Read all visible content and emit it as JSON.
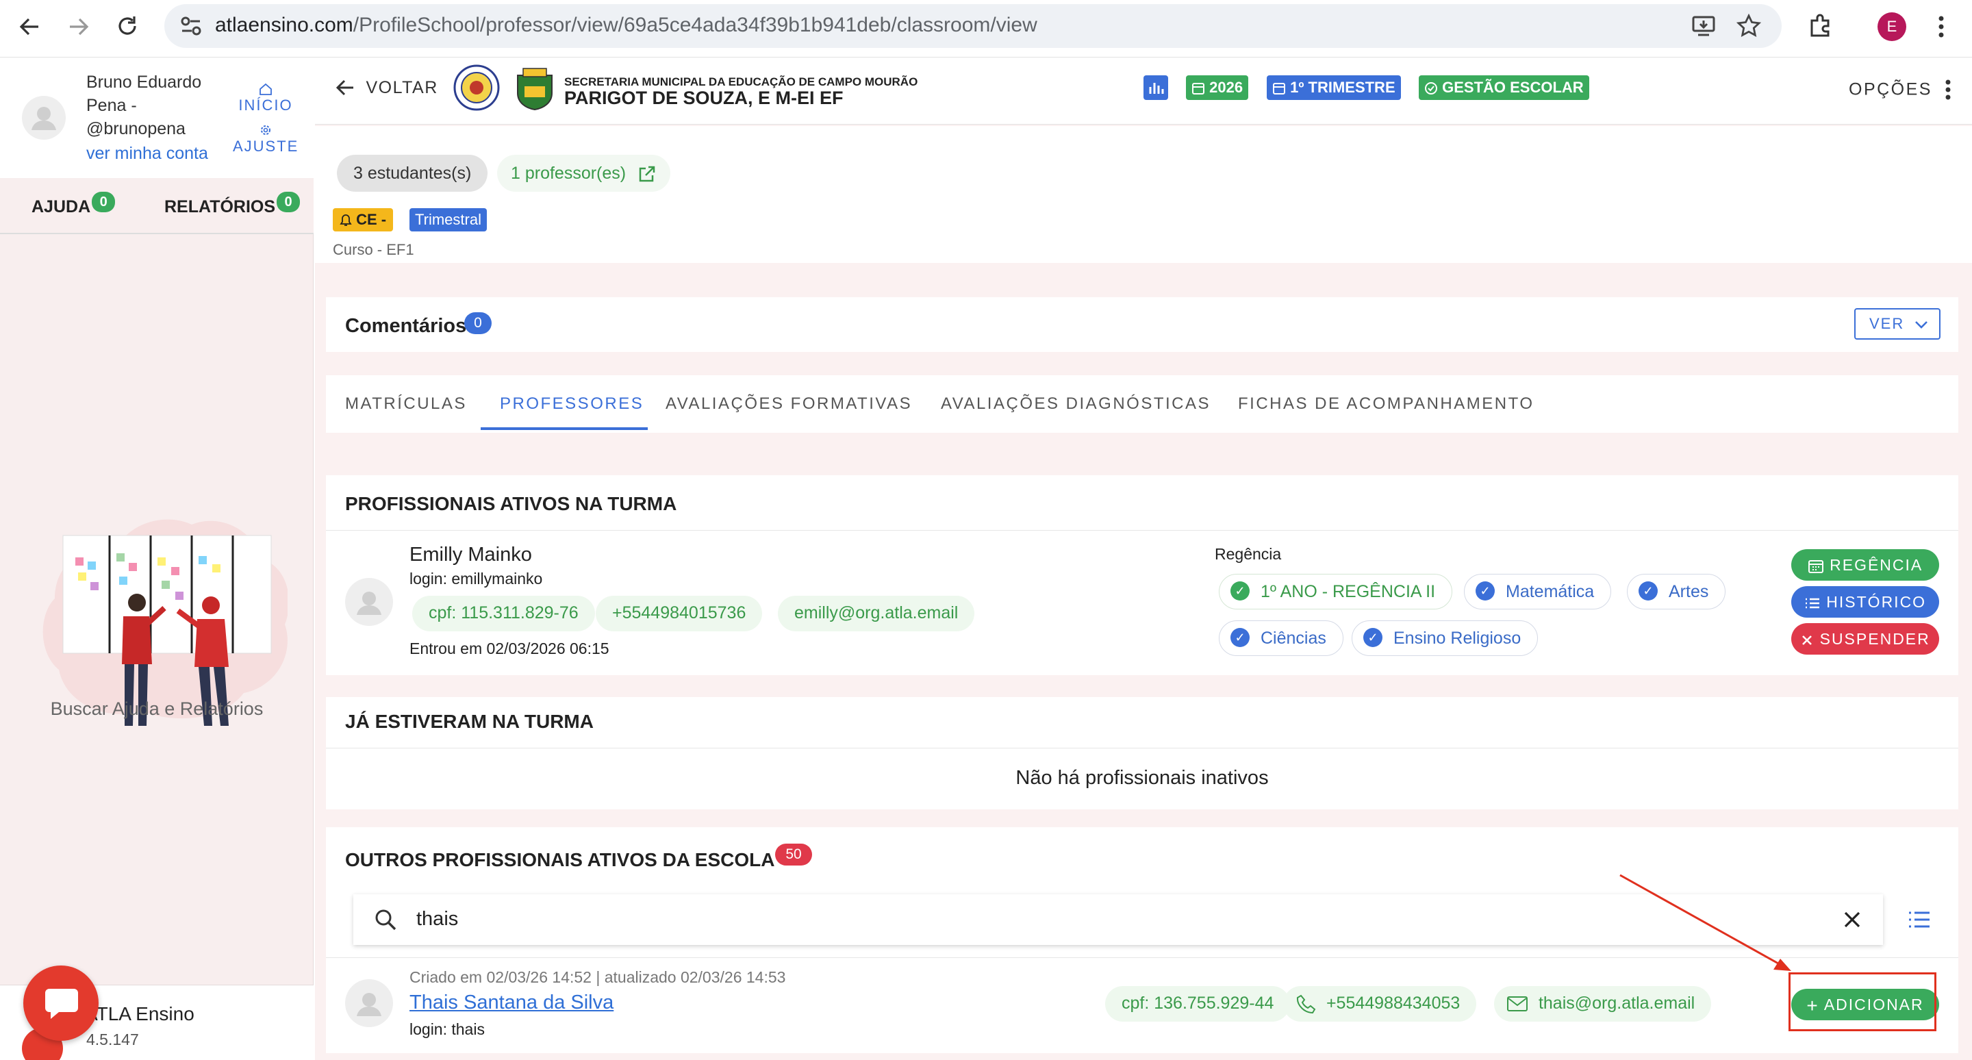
{
  "browser": {
    "url_host": "atlaensino.com",
    "url_path": "/ProfileSchool/professor/view/69a5ce4ada34f39b1b941deb/classroom/view",
    "profile_letter": "E"
  },
  "sidebar": {
    "user_name_line1": "Bruno Eduardo",
    "user_name_line2": "Pena -",
    "user_handle": "@brunopena",
    "account_link": "ver minha conta",
    "home_label": "INÍCIO",
    "settings_label": "AJUSTE",
    "tabs": [
      {
        "label": "AJUDA",
        "count": "0"
      },
      {
        "label": "RELATÓRIOS",
        "count": "0"
      }
    ],
    "help_caption": "Buscar Ajuda e Relatórios",
    "app_name": "ATLA Ensino",
    "app_version": "4.5.147"
  },
  "header": {
    "back_label": "VOLTAR",
    "secretaria": "SECRETARIA MUNICIPAL DA EDUCAÇÃO DE CAMPO MOURÃO",
    "school_name": "PARIGOT DE SOUZA, E M-EI EF",
    "year": "2026",
    "term": "1º TRIMESTRE",
    "management": "GESTÃO ESCOLAR",
    "options": "OPÇÕES"
  },
  "classroom": {
    "students": "3 estudantes(s)",
    "teachers": "1 professor(es)",
    "tag_ce": "CE -",
    "tag_period": "Trimestral",
    "course": "Curso - EF1"
  },
  "comments": {
    "title": "Comentários",
    "count": "0",
    "view_label": "VER"
  },
  "tabs": [
    {
      "label": "MATRÍCULAS",
      "active": false
    },
    {
      "label": "PROFESSORES",
      "active": true
    },
    {
      "label": "AVALIAÇÕES FORMATIVAS",
      "active": false
    },
    {
      "label": "AVALIAÇÕES DIAGNÓSTICAS",
      "active": false
    },
    {
      "label": "FICHAS DE ACOMPANHAMENTO",
      "active": false
    }
  ],
  "active_section": {
    "title": "PROFISSIONAIS ATIVOS NA TURMA",
    "teacher": {
      "name": "Emilly Mainko",
      "login": "login: emillymainko",
      "cpf": "cpf: 115.311.829-76",
      "phone": "+5544984015736",
      "email": "emilly@org.atla.email",
      "joined": "Entrou em 02/03/2026 06:15",
      "role_title": "Regência",
      "subjects": [
        "1º ANO - REGÊNCIA II",
        "Matemática",
        "Artes",
        "Ciências",
        "Ensino Religioso"
      ],
      "buttons": {
        "regencia": "REGÊNCIA",
        "historico": "HISTÓRICO",
        "suspender": "SUSPENDER"
      }
    }
  },
  "past_section": {
    "title": "JÁ ESTIVERAM NA TURMA",
    "empty_text": "Não há profissionais inativos"
  },
  "others_section": {
    "title": "OUTROS PROFISSIONAIS ATIVOS DA ESCOLA",
    "count": "50",
    "search_value": "thais",
    "result": {
      "meta": "Criado em 02/03/26 14:52 | atualizado 02/03/26 14:53",
      "name": "Thais Santana da Silva",
      "login": "login: thais",
      "cpf": "cpf: 136.755.929-44",
      "phone": "+5544988434053",
      "email": "thais@org.atla.email",
      "add_label": "ADICIONAR"
    }
  },
  "colors": {
    "green": "#3aaa5c",
    "blue": "#3b6fd8",
    "red": "#e0394a",
    "annotation_red": "#e0301e"
  }
}
